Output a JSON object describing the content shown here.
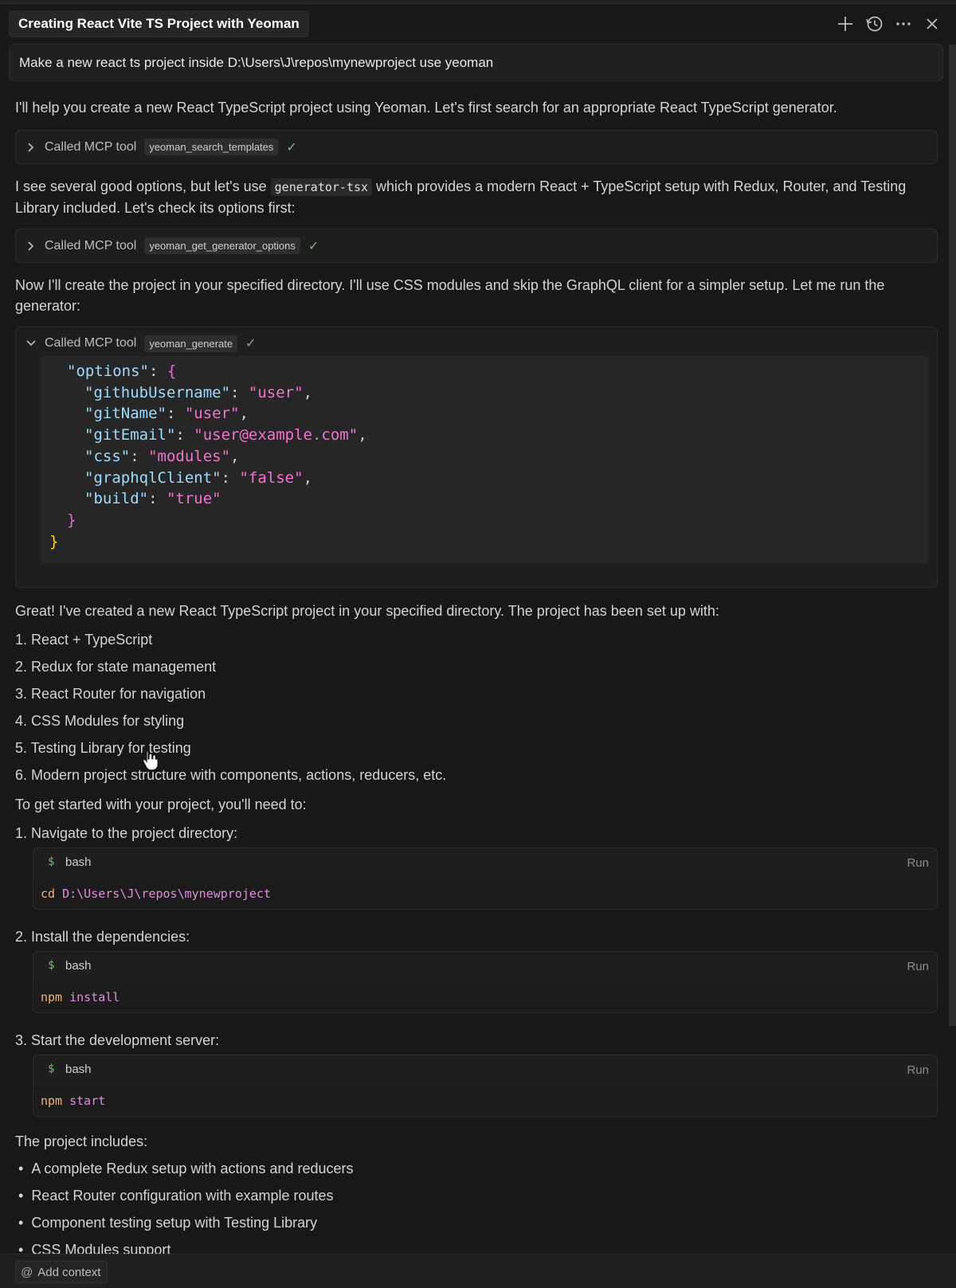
{
  "header": {
    "title": "Creating React Vite TS Project with Yeoman",
    "icons": [
      "plus-icon",
      "history-icon",
      "more-icon",
      "close-icon"
    ]
  },
  "prompt": "Make a new react ts project inside D:\\Users\\J\\repos\\mynewproject use yeoman",
  "messages": {
    "intro": "I'll help you create a new React TypeScript project using Yeoman. Let's first search for an appropriate React TypeScript generator.",
    "options_pre": "I see several good options, but let's use ",
    "options_code": "generator-tsx",
    "options_post": " which provides a modern React + TypeScript setup with Redux, Router, and Testing Library included. Let's check its options first:",
    "create": "Now I'll create the project in your specified directory. I'll use CSS modules and skip the GraphQL client for a simpler setup. Let me run the generator:",
    "great": "Great! I've created a new React TypeScript project in your specified directory. The project has been set up with:",
    "get_started": "To get started with your project, you'll need to:",
    "includes": "The project includes:"
  },
  "tool_calls": [
    {
      "label": "Called MCP tool",
      "tool": "yeoman_search_templates",
      "expanded": false
    },
    {
      "label": "Called MCP tool",
      "tool": "yeoman_get_generator_options",
      "expanded": false
    },
    {
      "label": "Called MCP tool",
      "tool": "yeoman_generate",
      "expanded": true
    }
  ],
  "tool_check": "✓",
  "generate_options": {
    "key": "\"options\"",
    "entries": [
      {
        "key": "\"githubUsername\"",
        "value": "\"user\"",
        "comma": ","
      },
      {
        "key": "\"gitName\"",
        "value": "\"user\"",
        "comma": ","
      },
      {
        "key": "\"gitEmail\"",
        "value": "\"user@example.com\"",
        "comma": ","
      },
      {
        "key": "\"css\"",
        "value": "\"modules\"",
        "comma": ","
      },
      {
        "key": "\"graphqlClient\"",
        "value": "\"false\"",
        "comma": ","
      },
      {
        "key": "\"build\"",
        "value": "\"true\"",
        "comma": ""
      }
    ]
  },
  "setup_list": [
    "1. React + TypeScript",
    "2. Redux for state management",
    "3. React Router for navigation",
    "4. CSS Modules for styling",
    "5. Testing Library for testing",
    "6. Modern project structure with components, actions, reducers, etc."
  ],
  "steps": [
    {
      "label": "1. Navigate to the project directory:",
      "lang": "bash",
      "run": "Run",
      "cmd": "cd",
      "args": "D:\\Users\\J\\repos\\mynewproject"
    },
    {
      "label": "2. Install the dependencies:",
      "lang": "bash",
      "run": "Run",
      "cmd": "npm",
      "args": "install"
    },
    {
      "label": "3. Start the development server:",
      "lang": "bash",
      "run": "Run",
      "cmd": "npm",
      "args": "start"
    }
  ],
  "includes_list": [
    "A complete Redux setup with actions and reducers",
    "React Router configuration with example routes",
    "Component testing setup with Testing Library",
    "CSS Modules support"
  ],
  "footer": {
    "add_context": "Add context"
  }
}
